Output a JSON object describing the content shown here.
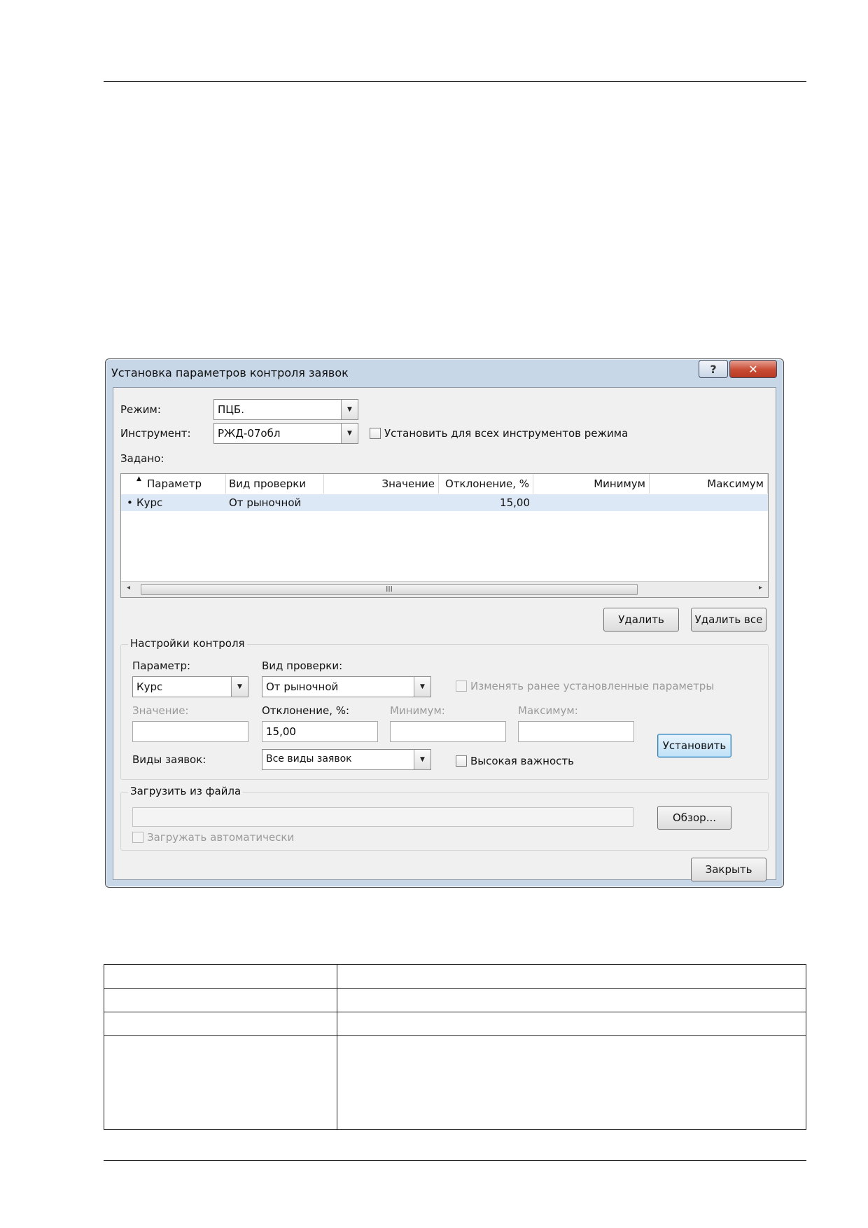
{
  "dialog": {
    "title": "Установка параметров контроля заявок",
    "help_icon": "question-icon",
    "close_icon": "close-icon"
  },
  "mode": {
    "label": "Режим:",
    "value": "ПЦБ."
  },
  "instrument": {
    "label": "Инструмент:",
    "value": "РЖД-07обл",
    "all_checkbox_label": "Установить для всех инструментов режима"
  },
  "assigned": {
    "label": "Задано:",
    "columns": [
      "Параметр",
      "Вид проверки",
      "Значение",
      "Отклонение, %",
      "Минимум",
      "Максимум"
    ],
    "rows": [
      {
        "marker": "•",
        "param": "Курс",
        "check": "От рыночной",
        "value": "",
        "deviation": "15,00",
        "min": "",
        "max": ""
      }
    ],
    "scroll_thumb_grip": "III"
  },
  "buttons": {
    "delete": "Удалить",
    "delete_all": "Удалить все",
    "set": "Установить",
    "browse": "Обзор...",
    "close": "Закрыть"
  },
  "control_settings": {
    "title": "Настройки контроля",
    "param_label": "Параметр:",
    "param_value": "Курс",
    "check_label": "Вид проверки:",
    "check_value": "От рыночной",
    "change_prev_label": "Изменять ранее установленные параметры",
    "value_label": "Значение:",
    "deviation_label": "Отклонение, %:",
    "deviation_value": "15,00",
    "min_label": "Минимум:",
    "max_label": "Максимум:",
    "order_types_label": "Виды заявок:",
    "order_types_value": "Все виды заявок",
    "high_priority_label": "Высокая важность"
  },
  "load_file": {
    "title": "Загрузить из файла",
    "path": "",
    "auto_label": "Загружать автоматически"
  },
  "doc_table": {
    "rows": [
      [
        "",
        ""
      ],
      [
        "",
        ""
      ],
      [
        "",
        ""
      ],
      [
        "",
        ""
      ]
    ]
  }
}
